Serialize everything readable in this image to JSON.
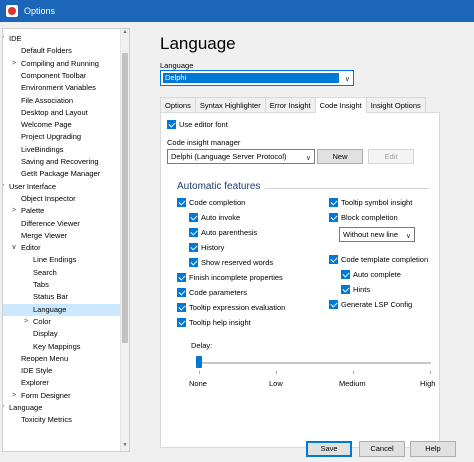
{
  "window": {
    "title": "Options"
  },
  "tree": {
    "items": [
      {
        "label": "IDE",
        "expander": "∨",
        "level": 0
      },
      {
        "label": "Default Folders",
        "expander": "",
        "level": 1
      },
      {
        "label": "Compiling and Running",
        "expander": ">",
        "level": 1
      },
      {
        "label": "Component Toolbar",
        "expander": "",
        "level": 1
      },
      {
        "label": "Environment Variables",
        "expander": "",
        "level": 1
      },
      {
        "label": "File Association",
        "expander": "",
        "level": 1
      },
      {
        "label": "Desktop and Layout",
        "expander": "",
        "level": 1
      },
      {
        "label": "Welcome Page",
        "expander": "",
        "level": 1
      },
      {
        "label": "Project Upgrading",
        "expander": "",
        "level": 1
      },
      {
        "label": "LiveBindings",
        "expander": "",
        "level": 1
      },
      {
        "label": "Saving and Recovering",
        "expander": "",
        "level": 1
      },
      {
        "label": "GetIt Package Manager",
        "expander": "",
        "level": 1
      },
      {
        "label": "User Interface",
        "expander": "∨",
        "level": 0
      },
      {
        "label": "Object Inspector",
        "expander": "",
        "level": 1
      },
      {
        "label": "Palette",
        "expander": ">",
        "level": 1
      },
      {
        "label": "Difference Viewer",
        "expander": "",
        "level": 1
      },
      {
        "label": "Merge Viewer",
        "expander": "",
        "level": 1
      },
      {
        "label": "Editor",
        "expander": "∨",
        "level": 1
      },
      {
        "label": "Line Endings",
        "expander": "",
        "level": 2
      },
      {
        "label": "Search",
        "expander": "",
        "level": 2
      },
      {
        "label": "Tabs",
        "expander": "",
        "level": 2
      },
      {
        "label": "Status Bar",
        "expander": "",
        "level": 2
      },
      {
        "label": "Language",
        "expander": "",
        "level": 2,
        "selected": true
      },
      {
        "label": "Color",
        "expander": ">",
        "level": 2
      },
      {
        "label": "Display",
        "expander": "",
        "level": 2
      },
      {
        "label": "Key Mappings",
        "expander": "",
        "level": 2
      },
      {
        "label": "Reopen Menu",
        "expander": "",
        "level": 1
      },
      {
        "label": "IDE Style",
        "expander": "",
        "level": 1
      },
      {
        "label": "Explorer",
        "expander": "",
        "level": 1
      },
      {
        "label": "Form Designer",
        "expander": ">",
        "level": 1
      },
      {
        "label": "Language",
        "expander": "∨",
        "level": 0
      },
      {
        "label": "Toxicity Metrics",
        "expander": "",
        "level": 1
      }
    ]
  },
  "main": {
    "title": "Language",
    "language_label": "Language",
    "language_value": "Delphi",
    "tabs": [
      {
        "label": "Options"
      },
      {
        "label": "Syntax Highlighter"
      },
      {
        "label": "Error Insight"
      },
      {
        "label": "Code Insight",
        "active": true
      },
      {
        "label": "Insight Options"
      }
    ],
    "use_editor_font": {
      "label": "Use editor font",
      "checked": true
    },
    "manager_label": "Code insight manager",
    "manager_value": "Delphi (Language Server Protocol)",
    "new_button": "New",
    "edit_button": "Edit",
    "auto_features_title": "Automatic features",
    "left_features": [
      {
        "label": "Code completion",
        "checked": true
      },
      {
        "label": "Auto invoke",
        "checked": true
      },
      {
        "label": "Auto parenthesis",
        "checked": true
      },
      {
        "label": "History",
        "checked": true
      },
      {
        "label": "Show reserved words",
        "checked": true
      },
      {
        "label": "Finish incomplete properties",
        "checked": true
      },
      {
        "label": "Code parameters",
        "checked": true
      },
      {
        "label": "Tooltip expression evaluation",
        "checked": true
      },
      {
        "label": "Tooltip help insight",
        "checked": true
      }
    ],
    "right_features": [
      {
        "label": "Tooltip symbol insight",
        "checked": true
      },
      {
        "label": "Block completion",
        "checked": true
      },
      {
        "label": "Code template completion",
        "checked": true
      },
      {
        "label": "Auto complete",
        "checked": true
      },
      {
        "label": "Hints",
        "checked": true
      },
      {
        "label": "Generate LSP Config",
        "checked": true
      }
    ],
    "block_completion_value": "Without new line",
    "delay": {
      "label": "Delay:",
      "value_fraction": 0,
      "ticks": [
        "None",
        "Low",
        "Medium",
        "High"
      ]
    }
  },
  "footer": {
    "save": "Save",
    "cancel": "Cancel",
    "help": "Help"
  },
  "colors": {
    "titlebar": "#1b66b8",
    "accent": "#0078d7",
    "selection": "#cce8ff",
    "group_title": "#1e3c78"
  }
}
